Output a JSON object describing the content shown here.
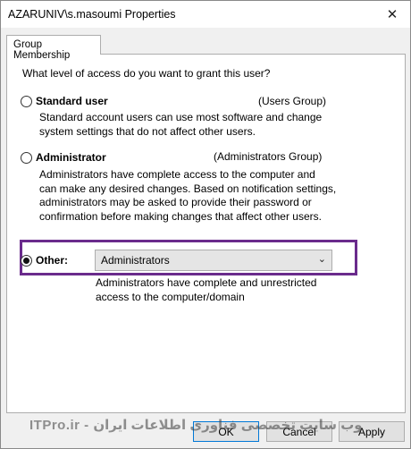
{
  "window": {
    "title": "AZARUNIV\\s.masoumi Properties"
  },
  "tabs": [
    {
      "label": "Group Membership"
    }
  ],
  "question": "What level of access do you want to grant this user?",
  "options": {
    "standard": {
      "label": "Standard user",
      "group": "(Users Group)",
      "description_lines": [
        "Standard account users can use most software and change",
        "system settings that do not affect other users."
      ],
      "selected": false
    },
    "administrator": {
      "label": "Administrator",
      "group": "(Administrators Group)",
      "description_lines": [
        "Administrators have complete access to the computer and",
        "can make any desired changes. Based on notification settings,",
        "administrators may be asked to provide their password or",
        "confirmation before making changes that affect other users."
      ],
      "selected": false
    },
    "other": {
      "label": "Other:",
      "selected_value": "Administrators",
      "description_lines": [
        "Administrators have complete and unrestricted",
        "access to the computer/domain"
      ],
      "selected": true
    }
  },
  "buttons": {
    "ok": "OK",
    "cancel": "Cancel",
    "apply": "Apply"
  },
  "watermark": "ITPro.ir - وب سایت تخصصی فناوری اطلاعات ایران",
  "colors": {
    "highlight": "#6a2b8c",
    "default_button_border": "#0078d7"
  },
  "icons": {
    "close": "close-icon",
    "dropdown": "chevron-down-icon"
  }
}
